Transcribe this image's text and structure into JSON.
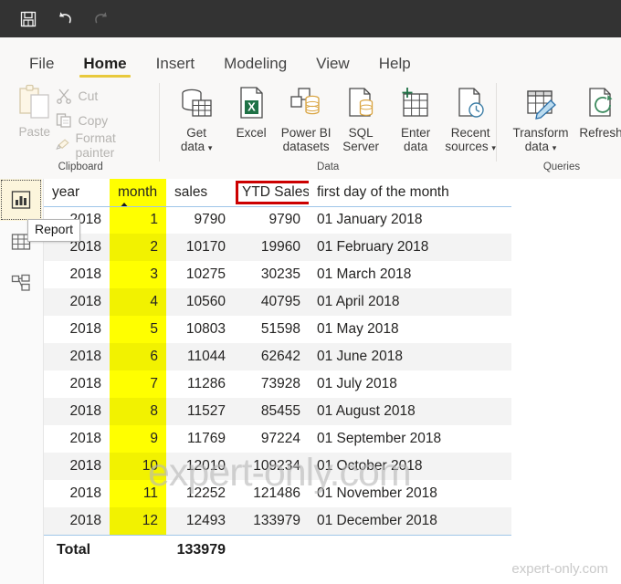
{
  "titlebar": {
    "buttons": [
      {
        "name": "save",
        "label": "Save",
        "icon": "save-icon",
        "enabled": true
      },
      {
        "name": "undo",
        "label": "Undo",
        "icon": "undo-icon",
        "enabled": true
      },
      {
        "name": "redo",
        "label": "Redo",
        "icon": "redo-icon",
        "enabled": false
      }
    ]
  },
  "ribbon": {
    "tabs": [
      {
        "label": "File",
        "active": false
      },
      {
        "label": "Home",
        "active": true
      },
      {
        "label": "Insert",
        "active": false
      },
      {
        "label": "Modeling",
        "active": false
      },
      {
        "label": "View",
        "active": false
      },
      {
        "label": "Help",
        "active": false
      }
    ],
    "groups": {
      "clipboard": {
        "label": "Clipboard",
        "paste": "Paste",
        "items": [
          {
            "label": "Cut",
            "icon": "scissors-icon"
          },
          {
            "label": "Copy",
            "icon": "copy-icon"
          },
          {
            "label": "Format painter",
            "icon": "format-painter-icon"
          }
        ]
      },
      "data": {
        "label": "Data",
        "items": [
          {
            "line1": "Get",
            "line2": "data",
            "caret": true,
            "icon": "get-data-icon"
          },
          {
            "line1": "Excel",
            "line2": "",
            "caret": false,
            "icon": "excel-icon"
          },
          {
            "line1": "Power BI",
            "line2": "datasets",
            "caret": false,
            "icon": "powerbi-datasets-icon"
          },
          {
            "line1": "SQL",
            "line2": "Server",
            "caret": false,
            "icon": "sql-server-icon"
          },
          {
            "line1": "Enter",
            "line2": "data",
            "caret": false,
            "icon": "enter-data-icon"
          },
          {
            "line1": "Recent",
            "line2": "sources",
            "caret": true,
            "icon": "recent-sources-icon"
          }
        ]
      },
      "queries": {
        "label": "Queries",
        "items": [
          {
            "line1": "Transform",
            "line2": "data",
            "caret": true,
            "icon": "transform-data-icon"
          },
          {
            "line1": "Refresh",
            "line2": "",
            "caret": false,
            "icon": "refresh-icon"
          }
        ]
      }
    }
  },
  "navbar": {
    "items": [
      {
        "name": "report",
        "label": "Report",
        "icon": "bar-chart-icon",
        "selected": true
      },
      {
        "name": "data",
        "label": "Data",
        "icon": "table-grid-icon",
        "selected": false
      },
      {
        "name": "model",
        "label": "Model",
        "icon": "model-relationships-icon",
        "selected": false
      }
    ],
    "tooltip": "Report"
  },
  "table": {
    "columns": [
      {
        "key": "year",
        "label": "year",
        "highlight": false,
        "sorted": false,
        "boxed": false
      },
      {
        "key": "month",
        "label": "month",
        "highlight": true,
        "sorted": true,
        "boxed": false,
        "sort_direction": "asc"
      },
      {
        "key": "sales",
        "label": "sales",
        "highlight": false,
        "sorted": false,
        "boxed": false
      },
      {
        "key": "ytd",
        "label": "YTD Sales",
        "highlight": false,
        "sorted": false,
        "boxed": true
      },
      {
        "key": "day",
        "label": "first day of the month",
        "highlight": false,
        "sorted": false,
        "boxed": false
      }
    ],
    "rows": [
      {
        "year": "2018",
        "month": "1",
        "sales": "9790",
        "ytd": "9790",
        "day": "01 January 2018",
        "ytd_highlight": false
      },
      {
        "year": "2018",
        "month": "2",
        "sales": "10170",
        "ytd": "19960",
        "day": "01 February 2018",
        "ytd_highlight": false
      },
      {
        "year": "2018",
        "month": "3",
        "sales": "10275",
        "ytd": "30235",
        "day": "01 March 2018",
        "ytd_highlight": false
      },
      {
        "year": "2018",
        "month": "4",
        "sales": "10560",
        "ytd": "40795",
        "day": "01 April 2018",
        "ytd_highlight": false
      },
      {
        "year": "2018",
        "month": "5",
        "sales": "10803",
        "ytd": "51598",
        "day": "01 May 2018",
        "ytd_highlight": false
      },
      {
        "year": "2018",
        "month": "6",
        "sales": "11044",
        "ytd": "62642",
        "day": "01 June 2018",
        "ytd_highlight": false
      },
      {
        "year": "2018",
        "month": "7",
        "sales": "11286",
        "ytd": "73928",
        "day": "01 July 2018",
        "ytd_highlight": false
      },
      {
        "year": "2018",
        "month": "8",
        "sales": "11527",
        "ytd": "85455",
        "day": "01 August 2018",
        "ytd_highlight": false
      },
      {
        "year": "2018",
        "month": "9",
        "sales": "11769",
        "ytd": "97224",
        "day": "01 September 2018",
        "ytd_highlight": false
      },
      {
        "year": "2018",
        "month": "10",
        "sales": "12010",
        "ytd": "109234",
        "day": "01 October 2018",
        "ytd_highlight": false
      },
      {
        "year": "2018",
        "month": "11",
        "sales": "12252",
        "ytd": "121486",
        "day": "01 November 2018",
        "ytd_highlight": false
      },
      {
        "year": "2018",
        "month": "12",
        "sales": "12493",
        "ytd": "133979",
        "day": "01 December 2018",
        "ytd_highlight": true
      }
    ],
    "total": {
      "label": "Total",
      "month": "",
      "sales": "133979",
      "ytd": "",
      "day": "",
      "sales_highlight": true
    }
  },
  "watermarks": {
    "center": "expert-only.com",
    "corner": "expert-only.com"
  },
  "colors": {
    "titlebar_bg": "#333333",
    "ribbon_bg": "#f9f8f7",
    "accent_tab": "#e8c93c",
    "highlight_yellow": "#ffff00",
    "red_box": "#cc0000",
    "row_alt": "#f3f3f3",
    "header_rule": "#9fc6e8",
    "excel_green": "#1e7145"
  }
}
